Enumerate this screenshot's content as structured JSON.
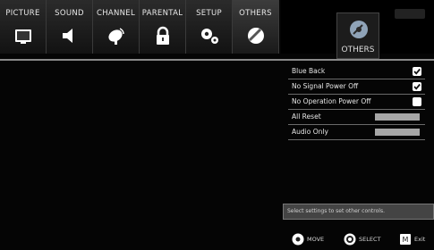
{
  "tabs": [
    {
      "label": "PICTURE",
      "icon": "tv-icon"
    },
    {
      "label": "SOUND",
      "icon": "speaker-icon"
    },
    {
      "label": "CHANNEL",
      "icon": "satellite-icon"
    },
    {
      "label": "PARENTAL",
      "icon": "lock-icon"
    },
    {
      "label": "SETUP",
      "icon": "gears-icon"
    },
    {
      "label": "OTHERS",
      "icon": "disc-icon"
    }
  ],
  "current_category": {
    "name": "OTHERS",
    "icon": "disc-icon"
  },
  "settings": [
    {
      "label": "Blue Back",
      "type": "checkbox",
      "checked": true
    },
    {
      "label": "No Signal Power Off",
      "type": "checkbox",
      "checked": true
    },
    {
      "label": "No Operation Power Off",
      "type": "checkbox",
      "checked": false
    },
    {
      "label": "All Reset",
      "type": "button"
    },
    {
      "label": "Audio Only",
      "type": "button"
    }
  ],
  "description": "Select settings to set other controls.",
  "hints": [
    {
      "icon": "dpad-icon",
      "label": "MOVE"
    },
    {
      "icon": "ok-button-icon",
      "label": "SELECT"
    },
    {
      "icon": "menu-icon",
      "label": "Exit"
    }
  ],
  "colors": {
    "background": "#050505",
    "tab_bg": "#1e1e1e",
    "divider": "#8a8a8a",
    "bar_button": "#a6a6a6"
  }
}
